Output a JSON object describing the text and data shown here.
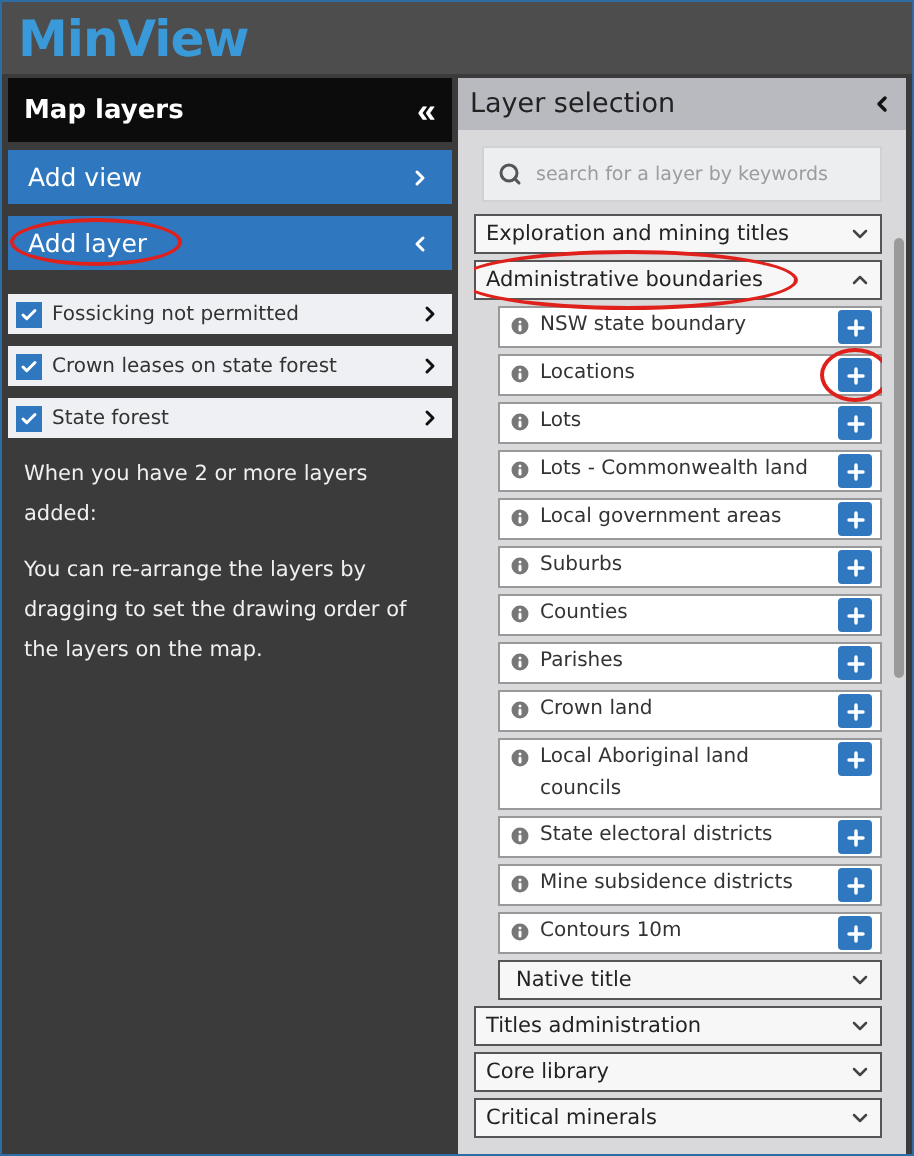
{
  "app": {
    "logo": "MinView"
  },
  "map_layers": {
    "title": "Map layers",
    "collapse_icon": "«",
    "actions": [
      {
        "label": "Add view",
        "expanded": false,
        "annotated": false
      },
      {
        "label": "Add layer",
        "expanded": true,
        "annotated": true
      }
    ],
    "layers": [
      {
        "label": "Fossicking not permitted",
        "checked": true
      },
      {
        "label": "Crown leases on state forest",
        "checked": true
      },
      {
        "label": "State forest",
        "checked": true
      }
    ],
    "help": [
      "When you have 2 or more layers added:",
      "You can re-arrange the layers by dragging to set the drawing order of the layers on the map."
    ]
  },
  "layer_selection": {
    "title": "Layer selection",
    "search": {
      "placeholder": "search for a layer by keywords"
    },
    "categories": [
      {
        "label": "Exploration and mining titles",
        "expanded": false,
        "annotated": false
      },
      {
        "label": "Administrative boundaries",
        "expanded": true,
        "annotated": true,
        "children": [
          {
            "kind": "layer",
            "label": "NSW state boundary",
            "annotated": false
          },
          {
            "kind": "layer",
            "label": "Locations",
            "annotated": true
          },
          {
            "kind": "layer",
            "label": "Lots",
            "annotated": false
          },
          {
            "kind": "layer",
            "label": "Lots - Commonwealth land",
            "annotated": false
          },
          {
            "kind": "layer",
            "label": "Local government areas",
            "annotated": false
          },
          {
            "kind": "layer",
            "label": "Suburbs",
            "annotated": false
          },
          {
            "kind": "layer",
            "label": "Counties",
            "annotated": false
          },
          {
            "kind": "layer",
            "label": "Parishes",
            "annotated": false
          },
          {
            "kind": "layer",
            "label": "Crown land",
            "annotated": false
          },
          {
            "kind": "layer",
            "label": "Local Aboriginal land councils",
            "annotated": false
          },
          {
            "kind": "layer",
            "label": "State electoral districts",
            "annotated": false
          },
          {
            "kind": "layer",
            "label": "Mine subsidence districts",
            "annotated": false
          },
          {
            "kind": "layer",
            "label": "Contours 10m",
            "annotated": false
          },
          {
            "kind": "group",
            "label": "Native title",
            "expanded": false
          }
        ]
      },
      {
        "label": "Titles administration",
        "expanded": false,
        "annotated": false
      },
      {
        "label": "Core library",
        "expanded": false,
        "annotated": false
      },
      {
        "label": "Critical minerals",
        "expanded": false,
        "annotated": false
      }
    ]
  }
}
